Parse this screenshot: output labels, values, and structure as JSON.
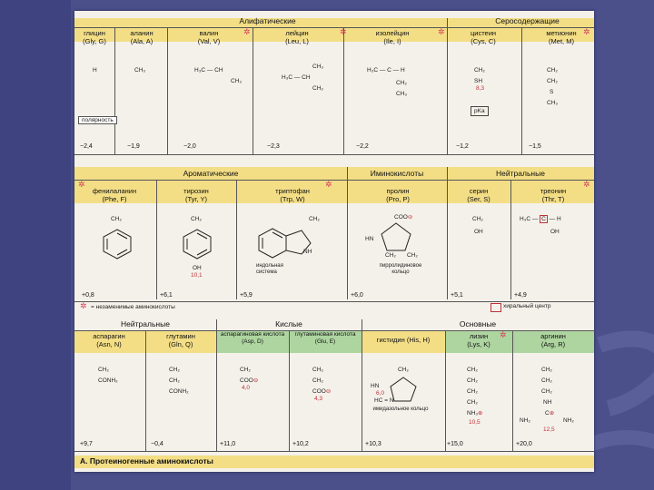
{
  "groups": {
    "aliphatic": "Алифатические",
    "sulfur": "Серосодержащие",
    "aromatic": "Ароматические",
    "imino": "Иминокислоты",
    "neutral_top": "Нейтральные",
    "neutral_bottom": "Нейтральные",
    "acidic": "Кислые",
    "basic": "Основные"
  },
  "row1": [
    {
      "name": "глицин",
      "code": "(Gly, G)",
      "side": "H",
      "pol": "−2,4"
    },
    {
      "name": "аланин",
      "code": "(Ala, A)",
      "side": "CH3",
      "pol": "−1,9"
    },
    {
      "name": "валин",
      "code": "(Val, V)",
      "side": "H3C−CH−CH3",
      "pol": "−2,0"
    },
    {
      "name": "лейцин",
      "code": "(Leu, L)",
      "side": "CH3−CH−CH3 / CH2",
      "pol": "−2,3"
    },
    {
      "name": "изолейцин",
      "code": "(Ile, I)",
      "side": "H3C−C−H / CH2 / CH3",
      "pol": "−2,2"
    },
    {
      "name": "цистеин",
      "code": "(Cys, C)",
      "side": "CH2 / SH",
      "pol": "−1,2"
    },
    {
      "name": "метионин",
      "code": "(Met, M)",
      "side": "CH2 / CH2 / S / CH3",
      "pol": "−1,5"
    }
  ],
  "row2": [
    {
      "name": "фенилаланин",
      "code": "(Phe, F)",
      "pol": "+0,8"
    },
    {
      "name": "тирозин",
      "code": "(Tyr, Y)",
      "pol": "+6,1"
    },
    {
      "name": "триптофан",
      "code": "(Trp, W)",
      "pol": "+5,9"
    },
    {
      "name": "пролин",
      "code": "(Pro, P)",
      "pol": "+6,0"
    },
    {
      "name": "серин",
      "code": "(Ser, S)",
      "pol": "+5,1"
    },
    {
      "name": "треонин",
      "code": "(Thr, T)",
      "pol": "+4,9"
    }
  ],
  "row3": [
    {
      "name": "аспарагин",
      "code": "(Asn, N)",
      "pol": "+9,7"
    },
    {
      "name": "глутамин",
      "code": "(Gln, Q)",
      "pol": "−0,4"
    },
    {
      "name": "аспарагиновая кислота",
      "code": "(Asp, D)",
      "pol": "+11,0"
    },
    {
      "name": "глутаминовая кислота",
      "code": "(Glu, E)",
      "pol": "+10,2"
    },
    {
      "name": "гистидин",
      "code": "(His, H)",
      "pol": "+10,3"
    },
    {
      "name": "лизин",
      "code": "(Lys, K)",
      "pol": "+15,0"
    },
    {
      "name": "аргинин",
      "code": "(Arg, R)",
      "pol": "+20,0"
    }
  ],
  "chem": {
    "H": "H",
    "CH3": "CH₃",
    "CH2": "CH₂",
    "CH": "CH",
    "H3C": "H₃C",
    "C": "C",
    "SH": "SH",
    "S": "S",
    "OH": "OH",
    "NH": "NH",
    "NH2": "NH₂",
    "NH3": "NH₃",
    "COO": "COO",
    "CONH2": "CONH₂",
    "HN": "HN",
    "HC": "HC",
    "N": "N",
    "O": "O"
  },
  "pk_values": {
    "cys": "8,3",
    "tyr": "10,1",
    "asp": "4,0",
    "glu": "4,3",
    "his": "6,0",
    "lys": "10,5",
    "arg": "12,5"
  },
  "labels": {
    "polarity": "полярность",
    "pka": "pKa",
    "indole": "индольная система",
    "pyrrolidine": "пирролидиновое кольцо",
    "imidazole": "имидазольное кольцо",
    "essential": "= незаменимые аминокислоты",
    "chiral": "хиральный центр",
    "caption": "A. Протеиногенные аминокислоты"
  },
  "colors": {
    "header_band": "#f3de86",
    "green_band": "#aed5a0",
    "pk": "#c0303a",
    "star": "#d5405a",
    "background": "#4b4f8a"
  }
}
